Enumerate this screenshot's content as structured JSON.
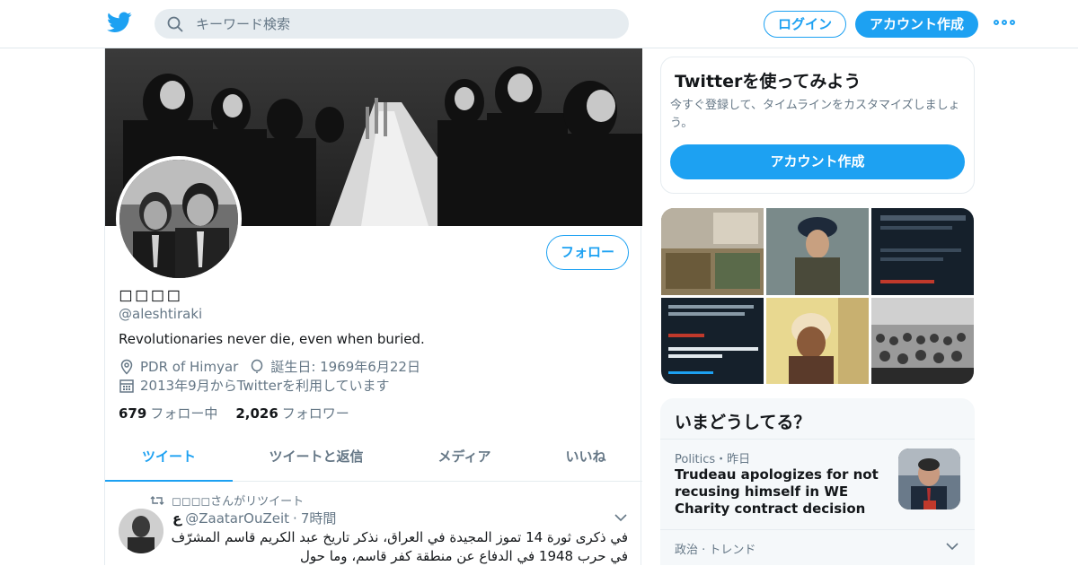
{
  "colors": {
    "accent": "#1da1f2",
    "muted": "#657786",
    "text": "#14171a",
    "border": "#e6ecf0"
  },
  "topbar": {
    "logo_icon": "twitter-bird-icon",
    "search_placeholder": "キーワード検索",
    "login_label": "ログイン",
    "signup_label": "アカウント作成",
    "more_icon": "more-dots-icon"
  },
  "profile": {
    "display_name": "◻◻◻◻",
    "handle": "@aleshtiraki",
    "bio": "Revolutionaries never die, even when buried.",
    "location": "PDR of Himyar",
    "birthday": "誕生日: 1969年6月22日",
    "joined": "2013年9月からTwitterを利用しています",
    "following_count": "679",
    "following_label": "フォロー中",
    "followers_count": "2,026",
    "followers_label": "フォロワー",
    "follow_button": "フォロー"
  },
  "tabs": [
    {
      "label": "ツイート",
      "active": true
    },
    {
      "label": "ツイートと返信"
    },
    {
      "label": "メディア"
    },
    {
      "label": "いいね"
    }
  ],
  "tweet": {
    "retweet_line": "◻◻◻◻さんがリツイート",
    "author_name": "ﻉ",
    "author_handle": "@ZaatarOuZeit",
    "time": "7時間",
    "text": "في ذكرى ثورة 14 تموز المجيدة في العراق، نذكر تاريخ عبد الكريم قاسم المشرّف في حرب 1948 في الدفاع عن منطقة كفر قاسم، وما حول"
  },
  "signup_card": {
    "title": "Twitterを使ってみよう",
    "description": "今すぐ登録して、タイムラインをカスタマイズしましょう。",
    "button": "アカウント作成"
  },
  "trends": {
    "title": "いまどうしてる？",
    "item1": {
      "category": "Politics・昨日",
      "title": "Trudeau apologizes for not recusing himself in WE Charity contract decision"
    },
    "item2": {
      "category": "政治 · トレンド"
    }
  }
}
